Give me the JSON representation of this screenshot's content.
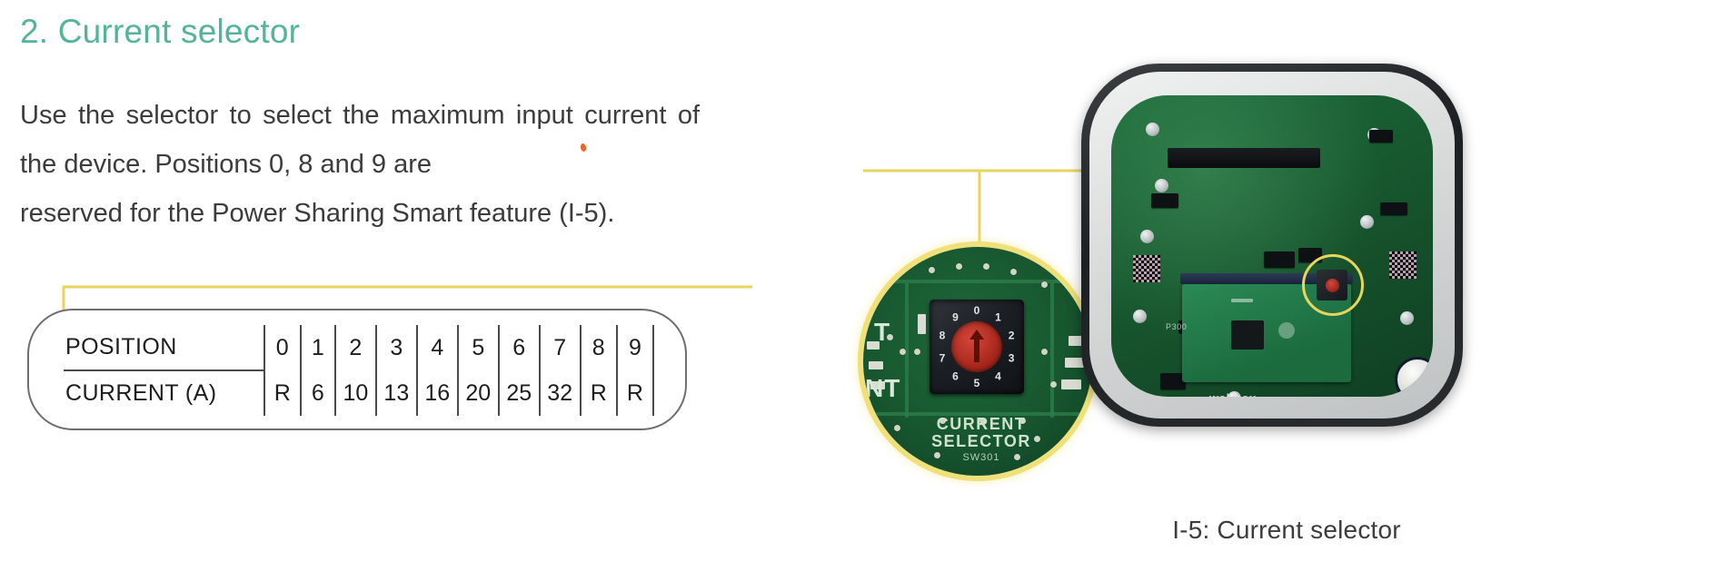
{
  "section": {
    "heading": "2. Current selector",
    "paragraph_line1": "Use the selector to select the maximum input",
    "paragraph_line2": "current of the device. Positions 0, 8 and 9 are",
    "paragraph_line3": "reserved for the Power Sharing Smart feature (I-5)."
  },
  "spec_table": {
    "row_labels": [
      "POSITION",
      "CURRENT (A)"
    ],
    "positions": [
      "0",
      "1",
      "2",
      "3",
      "4",
      "5",
      "6",
      "7",
      "8",
      "9"
    ],
    "currents": [
      "R",
      "6",
      "10",
      "13",
      "16",
      "20",
      "25",
      "32",
      "R",
      "R"
    ]
  },
  "figure": {
    "caption": "I-5: Current selector",
    "silkscreen": {
      "left_top": "T",
      "left_bottom": "NT",
      "component_name_line1": "CURRENT",
      "component_name_line2": "SELECTOR",
      "reference_designator": "SW301"
    },
    "dial_digits": [
      "0",
      "1",
      "2",
      "3",
      "4",
      "5",
      "6",
      "7",
      "8",
      "9"
    ],
    "board_labels": {
      "brand": "wallbox",
      "silk_p300": "P300"
    }
  },
  "colors": {
    "heading_teal": "#53b596",
    "body_text": "#3c3c3c",
    "callout_yellow": "#e8d65c",
    "accent_orange": "#f26322",
    "pcb_green": "#17562e",
    "dial_red": "#a8281d"
  }
}
